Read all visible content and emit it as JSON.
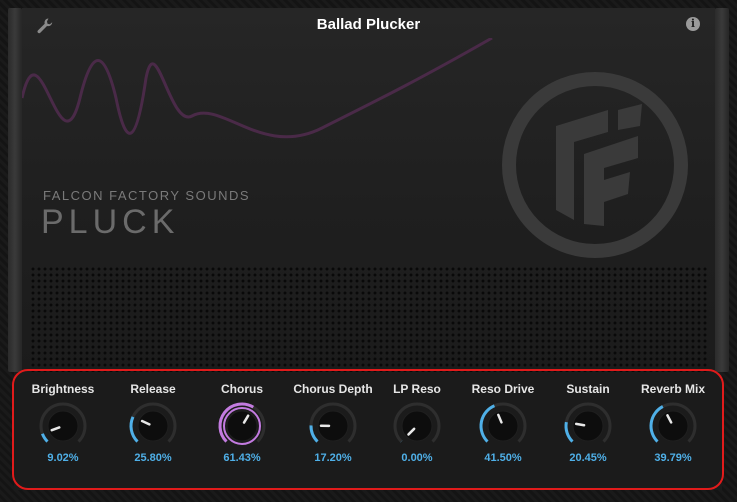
{
  "header": {
    "title": "Ballad Plucker",
    "settings_icon": "wrench-icon",
    "info_icon": "info-icon",
    "info_glyph": "i"
  },
  "brand": {
    "subtitle": "FALCON FACTORY SOUNDS",
    "name": "PLUCK",
    "logo_icon": "falcon-logo-icon"
  },
  "colors": {
    "accent_blue": "#4fb0e8",
    "accent_pink": "#c37be0",
    "highlight_red": "#e11b1b",
    "wave_purple": "#4a2a48"
  },
  "knobs": [
    {
      "label": "Brightness",
      "value_text": "9.02%",
      "value": 0.0902
    },
    {
      "label": "Release",
      "value_text": "25.80%",
      "value": 0.258
    },
    {
      "label": "Chorus",
      "value_text": "61.43%",
      "value": 0.6143,
      "active": true
    },
    {
      "label": "Chorus Depth",
      "value_text": "17.20%",
      "value": 0.172
    },
    {
      "label": "LP Reso",
      "value_text": "0.00%",
      "value": 0.0
    },
    {
      "label": "Reso Drive",
      "value_text": "41.50%",
      "value": 0.415
    },
    {
      "label": "Sustain",
      "value_text": "20.45%",
      "value": 0.2045
    },
    {
      "label": "Reverb Mix",
      "value_text": "39.79%",
      "value": 0.3979
    }
  ]
}
